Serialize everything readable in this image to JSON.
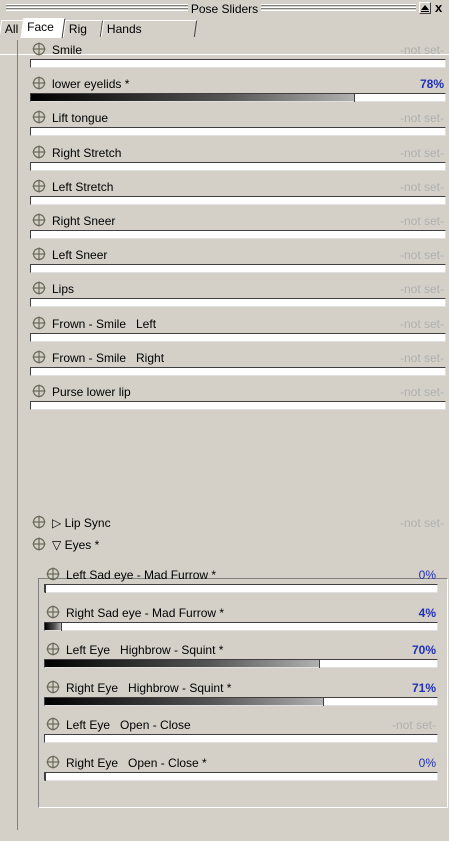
{
  "window": {
    "title": "Pose Sliders"
  },
  "tabs": [
    {
      "label": "All",
      "active": false
    },
    {
      "label": "Face",
      "active": true
    },
    {
      "label": "Rig",
      "active": false
    },
    {
      "label": "Hands",
      "active": false
    }
  ],
  "colors": {
    "value_set": "#2030b8",
    "value_unset": "#b0b0b0",
    "background": "#d4d0c8"
  },
  "sliders": [
    {
      "label": "Smile",
      "value": "-not set-"
    },
    {
      "label": "lower eyelids *",
      "value": "78%",
      "fraction": 0.78
    },
    {
      "label": "Lift tongue",
      "value": "-not set-"
    },
    {
      "label": "Right Stretch",
      "value": "-not set-"
    },
    {
      "label": "Left Stretch",
      "value": "-not set-"
    },
    {
      "label": "Right Sneer",
      "value": "-not set-"
    },
    {
      "label": "Left Sneer",
      "value": "-not set-"
    },
    {
      "label": "Lips",
      "value": "-not set-"
    },
    {
      "label": "Frown - Smile   Left",
      "value": "-not set-"
    },
    {
      "label": "Frown - Smile   Right",
      "value": "-not set-"
    },
    {
      "label": "Purse lower lip",
      "value": "-not set-"
    }
  ],
  "groups": {
    "lip_sync": {
      "label": "▷ Lip Sync",
      "value": "-not set-"
    },
    "eyes": {
      "label": "▽ Eyes *"
    }
  },
  "eye_sliders": [
    {
      "label": "Left Sad eye - Mad Furrow *",
      "value": "0%",
      "fraction": 0.0
    },
    {
      "label": "Right Sad eye - Mad Furrow *",
      "value": "4%",
      "fraction": 0.04
    },
    {
      "label": "Left Eye   Highbrow - Squint *",
      "value": "70%",
      "fraction": 0.7
    },
    {
      "label": "Right Eye   Highbrow - Squint *",
      "value": "71%",
      "fraction": 0.71
    },
    {
      "label": "Left Eye   Open - Close",
      "value": "-not set-"
    },
    {
      "label": "Right Eye   Open - Close *",
      "value": "0%",
      "fraction": 0.0
    }
  ]
}
